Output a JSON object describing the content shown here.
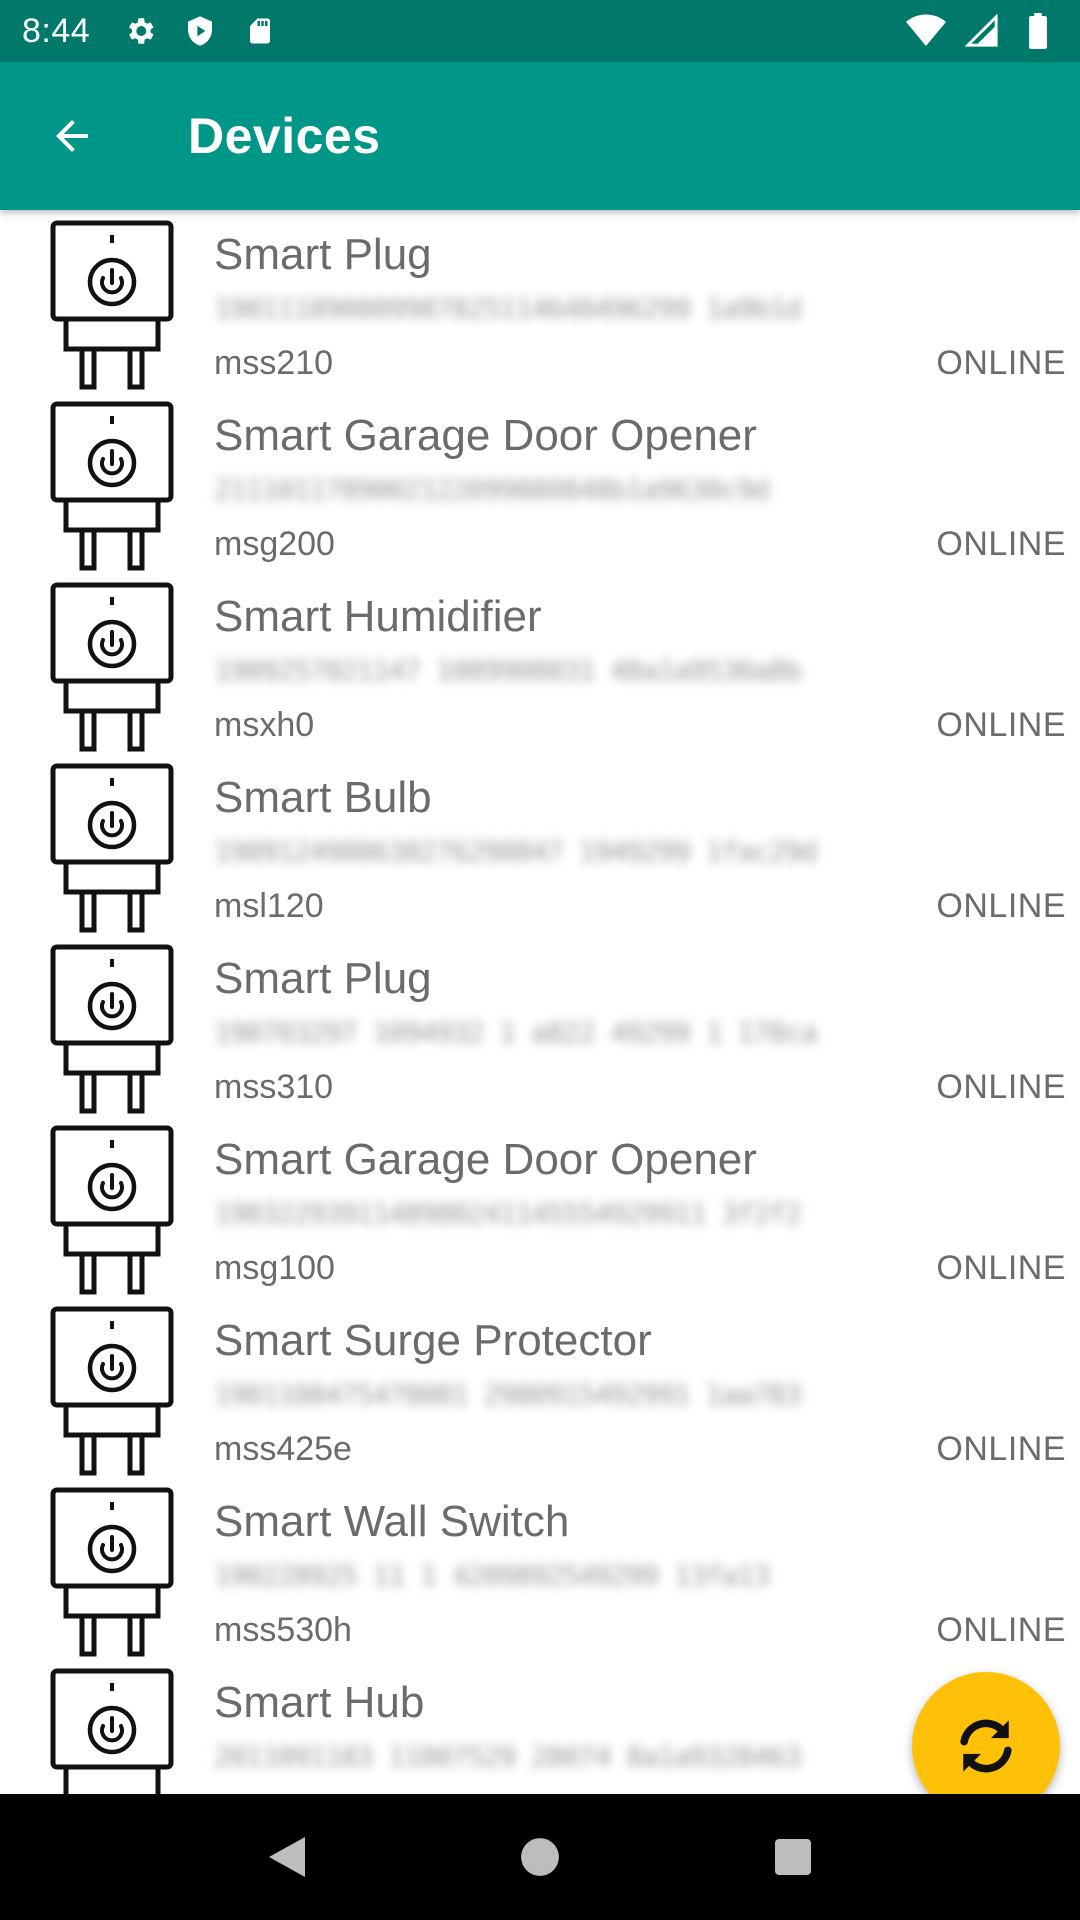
{
  "status_bar": {
    "time": "8:44",
    "icons": [
      "gear-icon",
      "shield-play-icon",
      "sd-card-icon",
      "wifi-icon",
      "signal-icon",
      "battery-icon"
    ]
  },
  "app_bar": {
    "title": "Devices",
    "back_icon": "arrow-back-icon",
    "color": "#009688"
  },
  "devices": [
    {
      "name": "Smart Plug",
      "id": "190111890809987825114648496299 1a9b1d",
      "model": "mss210",
      "status": "ONLINE"
    },
    {
      "name": "Smart Garage Door Opener",
      "id": "2111011789002122099880848b1a9630c9d",
      "model": "msg200",
      "status": "ONLINE"
    },
    {
      "name": "Smart Humidifier",
      "id": "1909257021147 1089908031 48a1a9530a8b",
      "model": "msxh0",
      "status": "ONLINE"
    },
    {
      "name": "Smart Bulb",
      "id": "1909124980638276298847 1949299 1fac29d",
      "model": "msl120",
      "status": "ONLINE"
    },
    {
      "name": "Smart Plug",
      "id": "190703297 1094932 1 a822 49299 1 178ca",
      "model": "mss310",
      "status": "ONLINE"
    },
    {
      "name": "Smart Garage Door Opener",
      "id": "1903229391148980241145554929911 3f2f2",
      "model": "msg100",
      "status": "ONLINE"
    },
    {
      "name": "Smart Surge Protector",
      "id": "1901108475478081 2980915492991 1aa783",
      "model": "mss425e",
      "status": "ONLINE"
    },
    {
      "name": "Smart Wall Switch",
      "id": "190228925 11 1 4209892549299 13fa13",
      "model": "mss530h",
      "status": "ONLINE"
    },
    {
      "name": "Smart Hub",
      "id": "2011091183 11807529 28074 8a1a9328463",
      "model": "",
      "status": ""
    }
  ],
  "fab": {
    "icon": "refresh-sync-icon",
    "color": "#FFC107"
  },
  "nav_bar": {
    "icons": [
      "back-triangle-icon",
      "home-circle-icon",
      "recents-square-icon"
    ]
  }
}
